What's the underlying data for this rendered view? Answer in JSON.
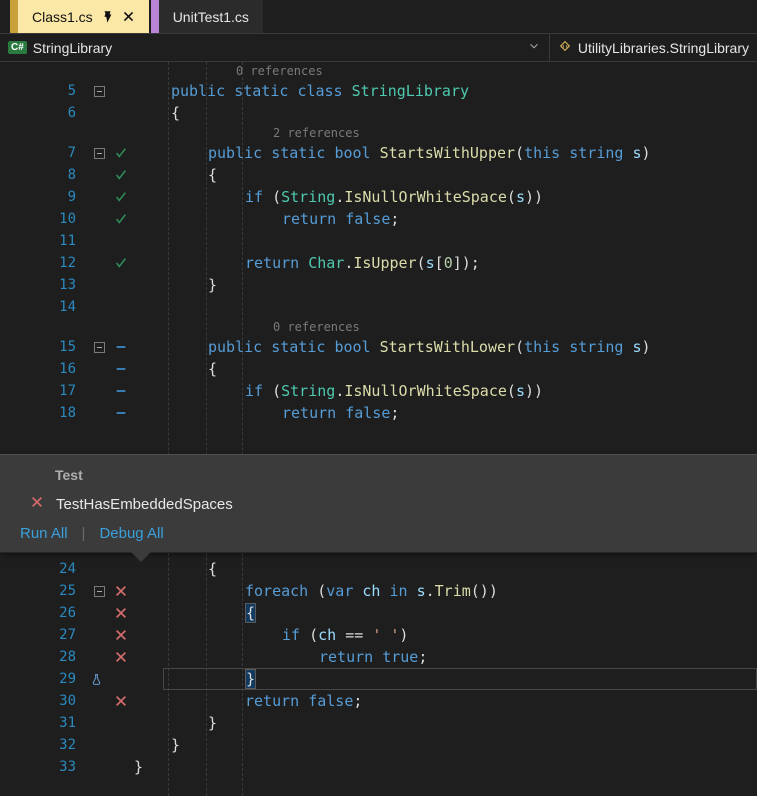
{
  "tabs": {
    "active": "Class1.cs",
    "inactive": "UnitTest1.cs"
  },
  "nav": {
    "left": "StringLibrary",
    "right": "UtilityLibraries.StringLibrary",
    "cs_badge": "C#"
  },
  "refs": {
    "zero": "0 references",
    "two": "2 references"
  },
  "lines": {
    "l05": {
      "n": "5",
      "fold": true,
      "mark": "",
      "indent": 0,
      "tokens": [
        [
          "kw",
          "public"
        ],
        [
          "txt",
          " "
        ],
        [
          "kw",
          "static"
        ],
        [
          "txt",
          " "
        ],
        [
          "kw",
          "class"
        ],
        [
          "txt",
          " "
        ],
        [
          "cls",
          "StringLibrary"
        ]
      ]
    },
    "l06": {
      "n": "6",
      "fold": false,
      "mark": "",
      "indent": 0,
      "tokens": [
        [
          "brace",
          "{"
        ]
      ]
    },
    "l07": {
      "n": "7",
      "fold": true,
      "mark": "pass",
      "indent": 1,
      "tokens": [
        [
          "kw",
          "public"
        ],
        [
          "txt",
          " "
        ],
        [
          "kw",
          "static"
        ],
        [
          "txt",
          " "
        ],
        [
          "kw",
          "bool"
        ],
        [
          "txt",
          " "
        ],
        [
          "mth",
          "StartsWithUpper"
        ],
        [
          "pun",
          "("
        ],
        [
          "kw",
          "this"
        ],
        [
          "txt",
          " "
        ],
        [
          "kw",
          "string"
        ],
        [
          "txt",
          " "
        ],
        [
          "param",
          "s"
        ],
        [
          "pun",
          ")"
        ]
      ]
    },
    "l08": {
      "n": "8",
      "fold": false,
      "mark": "pass",
      "indent": 1,
      "tokens": [
        [
          "brace",
          "{"
        ]
      ]
    },
    "l09": {
      "n": "9",
      "fold": false,
      "mark": "pass",
      "indent": 2,
      "tokens": [
        [
          "kw",
          "if"
        ],
        [
          "txt",
          " "
        ],
        [
          "pun",
          "("
        ],
        [
          "cls",
          "String"
        ],
        [
          "pun",
          "."
        ],
        [
          "mth",
          "IsNullOrWhiteSpace"
        ],
        [
          "pun",
          "("
        ],
        [
          "param",
          "s"
        ],
        [
          "pun",
          "))"
        ]
      ]
    },
    "l10": {
      "n": "10",
      "fold": false,
      "mark": "pass",
      "indent": 3,
      "tokens": [
        [
          "kw",
          "return"
        ],
        [
          "txt",
          " "
        ],
        [
          "kw",
          "false"
        ],
        [
          "pun",
          ";"
        ]
      ]
    },
    "l11": {
      "n": "11",
      "fold": false,
      "mark": "",
      "indent": 0,
      "tokens": []
    },
    "l12": {
      "n": "12",
      "fold": false,
      "mark": "pass",
      "indent": 2,
      "tokens": [
        [
          "kw",
          "return"
        ],
        [
          "txt",
          " "
        ],
        [
          "cls",
          "Char"
        ],
        [
          "pun",
          "."
        ],
        [
          "mth",
          "IsUpper"
        ],
        [
          "pun",
          "("
        ],
        [
          "param",
          "s"
        ],
        [
          "pun",
          "["
        ],
        [
          "num",
          "0"
        ],
        [
          "pun",
          "]);"
        ]
      ]
    },
    "l13": {
      "n": "13",
      "fold": false,
      "mark": "",
      "indent": 1,
      "tokens": [
        [
          "brace",
          "}"
        ]
      ]
    },
    "l14": {
      "n": "14",
      "fold": false,
      "mark": "",
      "indent": 0,
      "tokens": []
    },
    "l15": {
      "n": "15",
      "fold": true,
      "mark": "dash",
      "indent": 1,
      "tokens": [
        [
          "kw",
          "public"
        ],
        [
          "txt",
          " "
        ],
        [
          "kw",
          "static"
        ],
        [
          "txt",
          " "
        ],
        [
          "kw",
          "bool"
        ],
        [
          "txt",
          " "
        ],
        [
          "mth",
          "StartsWithLower"
        ],
        [
          "pun",
          "("
        ],
        [
          "kw",
          "this"
        ],
        [
          "txt",
          " "
        ],
        [
          "kw",
          "string"
        ],
        [
          "txt",
          " "
        ],
        [
          "param",
          "s"
        ],
        [
          "pun",
          ")"
        ]
      ]
    },
    "l16": {
      "n": "16",
      "fold": false,
      "mark": "dash",
      "indent": 1,
      "tokens": [
        [
          "brace",
          "{"
        ]
      ]
    },
    "l17": {
      "n": "17",
      "fold": false,
      "mark": "dash",
      "indent": 2,
      "tokens": [
        [
          "kw",
          "if"
        ],
        [
          "txt",
          " "
        ],
        [
          "pun",
          "("
        ],
        [
          "cls",
          "String"
        ],
        [
          "pun",
          "."
        ],
        [
          "mth",
          "IsNullOrWhiteSpace"
        ],
        [
          "pun",
          "("
        ],
        [
          "param",
          "s"
        ],
        [
          "pun",
          "))"
        ]
      ]
    },
    "l18": {
      "n": "18",
      "fold": false,
      "mark": "dash",
      "indent": 3,
      "tokens": [
        [
          "kw",
          "return"
        ],
        [
          "txt",
          " "
        ],
        [
          "kw",
          "false"
        ],
        [
          "pun",
          ";"
        ]
      ]
    },
    "l24": {
      "n": "24",
      "fold": false,
      "mark": "",
      "indent": 1,
      "tokens": [
        [
          "brace",
          "{"
        ]
      ]
    },
    "l25": {
      "n": "25",
      "fold": true,
      "mark": "fail",
      "indent": 2,
      "tokens": [
        [
          "kw",
          "foreach"
        ],
        [
          "txt",
          " "
        ],
        [
          "pun",
          "("
        ],
        [
          "kw",
          "var"
        ],
        [
          "txt",
          " "
        ],
        [
          "param",
          "ch"
        ],
        [
          "txt",
          " "
        ],
        [
          "kw",
          "in"
        ],
        [
          "txt",
          " "
        ],
        [
          "param",
          "s"
        ],
        [
          "pun",
          "."
        ],
        [
          "mth",
          "Trim"
        ],
        [
          "pun",
          "())"
        ]
      ]
    },
    "l26": {
      "n": "26",
      "fold": false,
      "mark": "fail",
      "indent": 2,
      "tokens": [
        [
          "sel-brace",
          "{"
        ]
      ]
    },
    "l27": {
      "n": "27",
      "fold": false,
      "mark": "fail",
      "indent": 3,
      "tokens": [
        [
          "kw",
          "if"
        ],
        [
          "txt",
          " "
        ],
        [
          "pun",
          "("
        ],
        [
          "param",
          "ch"
        ],
        [
          "txt",
          " "
        ],
        [
          "pun",
          "=="
        ],
        [
          "txt",
          " "
        ],
        [
          "str",
          "' '"
        ],
        [
          "pun",
          ")"
        ]
      ]
    },
    "l28": {
      "n": "28",
      "fold": false,
      "mark": "fail",
      "indent": 4,
      "tokens": [
        [
          "kw",
          "return"
        ],
        [
          "txt",
          " "
        ],
        [
          "kw",
          "true"
        ],
        [
          "pun",
          ";"
        ]
      ]
    },
    "l29": {
      "n": "29",
      "fold": false,
      "mark": "flask",
      "indent": 2,
      "tokens": [
        [
          "sel-brace",
          "}"
        ]
      ],
      "current": true
    },
    "l30": {
      "n": "30",
      "fold": false,
      "mark": "fail",
      "indent": 2,
      "tokens": [
        [
          "kw",
          "return"
        ],
        [
          "txt",
          " "
        ],
        [
          "kw",
          "false"
        ],
        [
          "pun",
          ";"
        ]
      ]
    },
    "l31": {
      "n": "31",
      "fold": false,
      "mark": "",
      "indent": 1,
      "tokens": [
        [
          "brace",
          "}"
        ]
      ]
    },
    "l32": {
      "n": "32",
      "fold": false,
      "mark": "",
      "indent": 0,
      "tokens": [
        [
          "brace",
          "}"
        ]
      ]
    },
    "l33": {
      "n": "33",
      "fold": false,
      "mark": "",
      "indent": -1,
      "tokens": [
        [
          "brace",
          "}"
        ]
      ]
    }
  },
  "popup": {
    "title": "Test",
    "test_name": "TestHasEmbeddedSpaces",
    "run_all": "Run All",
    "debug_all": "Debug All"
  }
}
